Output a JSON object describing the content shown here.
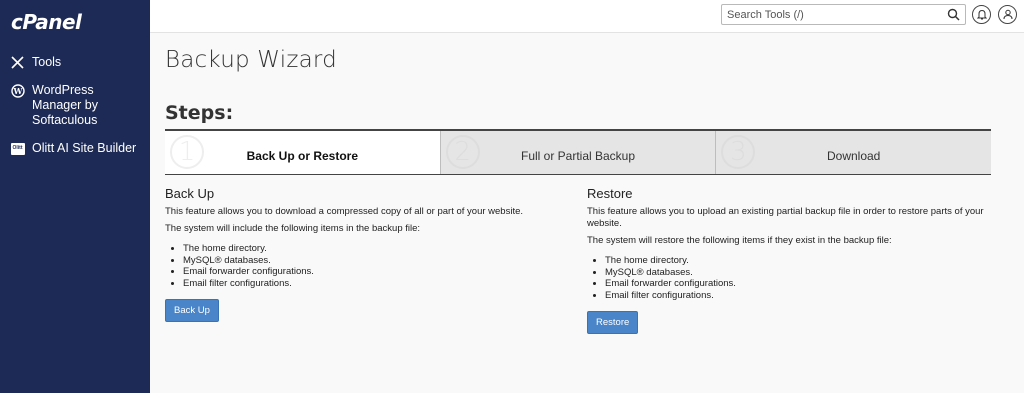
{
  "sidebar": {
    "logo": "cPanel",
    "items": [
      {
        "label": "Tools",
        "icon": "tools-icon"
      },
      {
        "label": "WordPress Manager by Softaculous",
        "icon": "wordpress-icon"
      },
      {
        "label": "Olitt AI Site Builder",
        "icon": "olitt-icon",
        "badge": "Olitt"
      }
    ]
  },
  "topbar": {
    "search_placeholder": "Search Tools (/)"
  },
  "page": {
    "title": "Backup Wizard",
    "steps_heading": "Steps:",
    "steps": [
      {
        "num": "1",
        "label": "Back Up or Restore",
        "active": true
      },
      {
        "num": "2",
        "label": "Full or Partial Backup",
        "active": false
      },
      {
        "num": "3",
        "label": "Download",
        "active": false
      }
    ]
  },
  "backup": {
    "heading": "Back Up",
    "desc": "This feature allows you to download a compressed copy of all or part of your website.",
    "list_intro": "The system will include the following items in the backup file:",
    "items": [
      "The home directory.",
      "MySQL® databases.",
      "Email forwarder configurations.",
      "Email filter configurations."
    ],
    "button": "Back Up"
  },
  "restore": {
    "heading": "Restore",
    "desc": "This feature allows you to upload an existing partial backup file in order to restore parts of your website.",
    "list_intro": "The system will restore the following items if they exist in the backup file:",
    "items": [
      "The home directory.",
      "MySQL® databases.",
      "Email forwarder configurations.",
      "Email filter configurations."
    ],
    "button": "Restore"
  },
  "colors": {
    "sidebar_bg": "#1d2a56",
    "button_bg": "#4a85c9"
  }
}
